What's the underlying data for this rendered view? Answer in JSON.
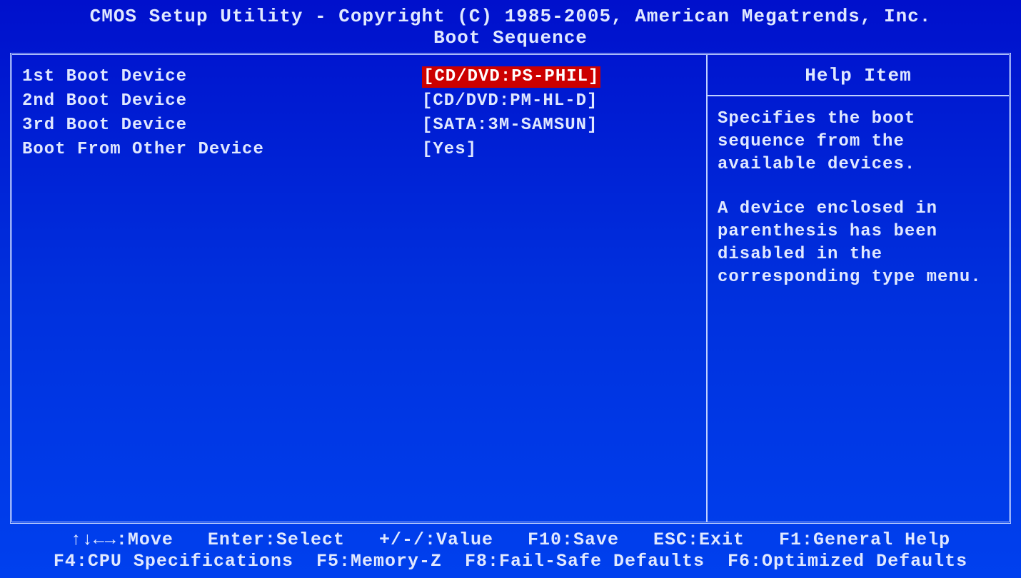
{
  "header": {
    "copyright": "CMOS Setup Utility - Copyright (C) 1985-2005, American Megatrends, Inc.",
    "page_title": "Boot Sequence"
  },
  "settings": [
    {
      "label": "1st Boot Device",
      "value": "[CD/DVD:PS-PHIL]",
      "selected": true
    },
    {
      "label": "2nd Boot Device",
      "value": "[CD/DVD:PM-HL-D]",
      "selected": false
    },
    {
      "label": "3rd Boot Device",
      "value": "[SATA:3M-SAMSUN]",
      "selected": false
    },
    {
      "label": "Boot From Other Device",
      "value": "[Yes]",
      "selected": false
    }
  ],
  "help": {
    "title": "Help Item",
    "paragraphs": [
      "Specifies the boot sequence from the available devices.",
      "A device enclosed in parenthesis has been disabled in the corresponding type menu."
    ]
  },
  "footer": {
    "line1": "↑↓←→:Move   Enter:Select   +/-/:Value   F10:Save   ESC:Exit   F1:General Help",
    "line2": "F4:CPU Specifications  F5:Memory-Z  F8:Fail-Safe Defaults  F6:Optimized Defaults"
  }
}
